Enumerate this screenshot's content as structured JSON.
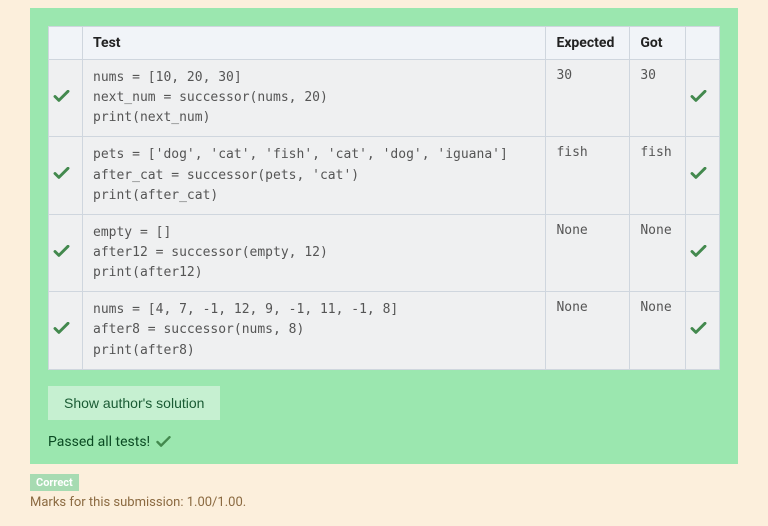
{
  "headers": {
    "test": "Test",
    "expected": "Expected",
    "got": "Got"
  },
  "rows": [
    {
      "code": "nums = [10, 20, 30]\nnext_num = successor(nums, 20)\nprint(next_num)",
      "expected": "30",
      "got": "30",
      "pass": true
    },
    {
      "code": "pets = ['dog', 'cat', 'fish', 'cat', 'dog', 'iguana']\nafter_cat = successor(pets, 'cat')\nprint(after_cat)",
      "expected": "fish",
      "got": "fish",
      "pass": true
    },
    {
      "code": "empty = []\nafter12 = successor(empty, 12)\nprint(after12)",
      "expected": "None",
      "got": "None",
      "pass": true
    },
    {
      "code": "nums = [4, 7, -1, 12, 9, -1, 11, -1, 8]\nafter8 = successor(nums, 8)\nprint(after8)",
      "expected": "None",
      "got": "None",
      "pass": true
    }
  ],
  "buttons": {
    "show_solution": "Show author's solution"
  },
  "status": {
    "passed_all": "Passed all tests!",
    "correct_badge": "Correct",
    "marks": "Marks for this submission: 1.00/1.00."
  },
  "colors": {
    "tick": "#43894e"
  }
}
